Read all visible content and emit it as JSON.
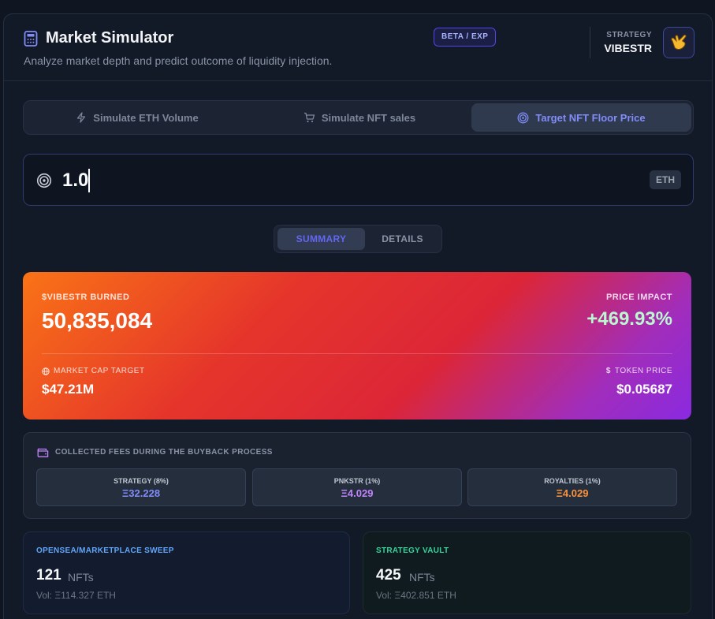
{
  "header": {
    "title": "Market Simulator",
    "subtitle": "Analyze market depth and predict outcome of liquidity injection.",
    "badge": "BETA / EXP",
    "strategy_label": "STRATEGY",
    "strategy_name": "VIBESTR",
    "icons": {
      "title": "calculator-icon",
      "avatar": "hand-shaka-icon"
    }
  },
  "mode_tabs": [
    {
      "label": "Simulate ETH Volume",
      "icon": "lightning-icon",
      "active": false
    },
    {
      "label": "Simulate NFT sales",
      "icon": "cart-icon",
      "active": false
    },
    {
      "label": "Target NFT Floor Price",
      "icon": "target-icon",
      "active": true
    }
  ],
  "input": {
    "value": "1.0",
    "unit": "ETH",
    "icon": "target-icon"
  },
  "view_toggle": {
    "summary": "SUMMARY",
    "details": "DETAILS",
    "selected": "SUMMARY"
  },
  "results": {
    "burned_label": "$VIBESTR BURNED",
    "burned_value": "50,835,084",
    "impact_label": "PRICE IMPACT",
    "impact_value": "+469.93%",
    "mcap_label": "MARKET CAP TARGET",
    "mcap_value": "$47.21M",
    "token_label": "TOKEN PRICE",
    "token_value": "$0.05687",
    "colors": {
      "gradient_start": "#f97316",
      "gradient_mid": "#dc2638",
      "gradient_end": "#8a2ae0",
      "impact": "#bbf7d0"
    }
  },
  "fees": {
    "title": "COLLECTED FEES DURING THE BUYBACK PROCESS",
    "icon": "wallet-icon",
    "items": [
      {
        "name": "STRATEGY (8%)",
        "value": "Ξ32.228",
        "color": "#818cf8"
      },
      {
        "name": "PNKSTR (1%)",
        "value": "Ξ4.029",
        "color": "#c084fc"
      },
      {
        "name": "ROYALTIES (1%)",
        "value": "Ξ4.029",
        "color": "#fb923c"
      }
    ]
  },
  "sweep": {
    "label": "OPENSEA/MARKETPLACE SWEEP",
    "count": "121",
    "unit": "NFTs",
    "volume": "Vol: Ξ114.327 ETH",
    "color": "#60a5fa"
  },
  "vault": {
    "label": "STRATEGY VAULT",
    "count": "425",
    "unit": "NFTs",
    "volume": "Vol: Ξ402.851 ETH",
    "color": "#34d399"
  }
}
